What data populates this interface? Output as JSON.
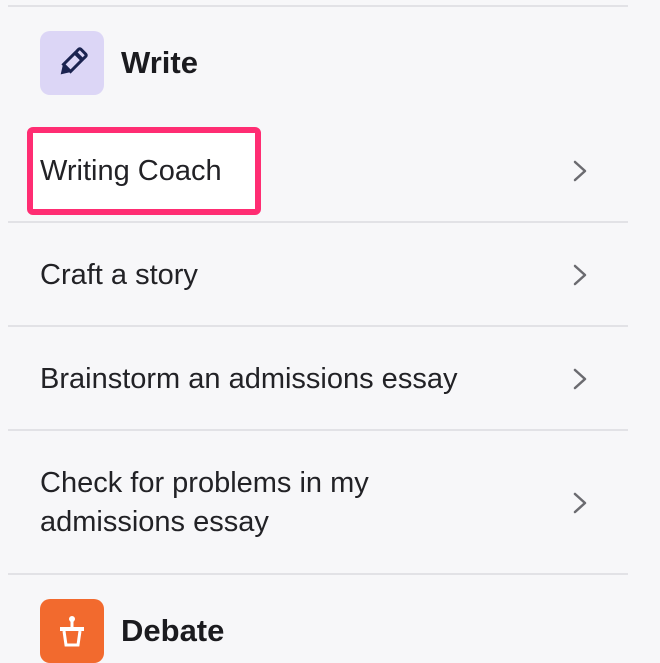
{
  "sections": {
    "write": {
      "title": "Write",
      "icon": "pencil-icon",
      "icon_bg": "#dcd6f6",
      "icon_color": "#1b2350"
    },
    "debate": {
      "title": "Debate",
      "icon": "podium-icon",
      "icon_bg": "#f26a2e",
      "icon_color": "#ffffff"
    }
  },
  "write_items": [
    {
      "label": "Writing Coach",
      "highlighted": true
    },
    {
      "label": "Craft a story"
    },
    {
      "label": "Brainstorm an admissions essay"
    },
    {
      "label": "Check for problems in my admissions essay"
    }
  ],
  "colors": {
    "highlight_border": "#ff2d73",
    "background": "#f7f7f9",
    "divider": "#e2e2e6"
  }
}
